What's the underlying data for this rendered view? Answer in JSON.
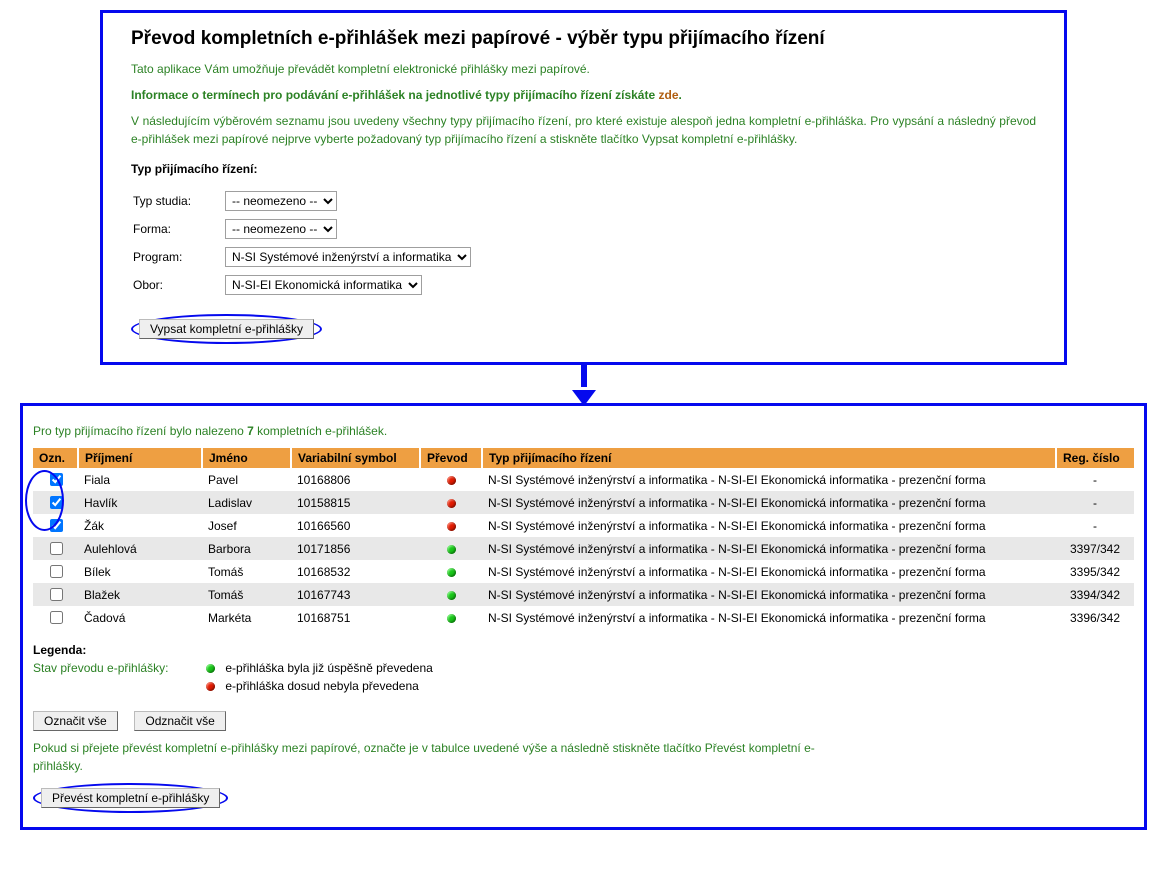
{
  "top": {
    "title": "Převod kompletních e-přihlášek mezi papírové - výběr typu přijímacího řízení",
    "intro": "Tato aplikace Vám umožňuje převádět kompletní elektronické přihlášky mezi papírové.",
    "info_prefix": "Informace o termínech pro podávání e-přihlášek na jednotlivé typy přijímacího řízení získáte ",
    "info_link": "zde",
    "info_suffix": ".",
    "desc": "V následujícím výběrovém seznamu jsou uvedeny všechny typy přijímacího řízení, pro které existuje alespoň jedna kompletní e-přihláška. Pro vypsání a následný převod e-přihlášek mezi papírové nejprve vyberte požadovaný typ přijímacího řízení a stiskněte tlačítko Vypsat kompletní e-přihlášky.",
    "sect_label": "Typ přijímacího řízení:",
    "form": {
      "typ_label": "Typ studia:",
      "typ_val": "-- neomezeno --",
      "forma_label": "Forma:",
      "forma_val": "-- neomezeno --",
      "program_label": "Program:",
      "program_val": "N-SI Systémové inženýrství a informatika",
      "obor_label": "Obor:",
      "obor_val": "N-SI-EI Ekonomická informatika"
    },
    "btn_list": "Vypsat kompletní e-přihlášky"
  },
  "bottom": {
    "found_pre": "Pro typ přijímacího řízení bylo nalezeno ",
    "found_n": "7",
    "found_post": " kompletních e-přihlášek.",
    "headers": {
      "ozn": "Ozn.",
      "prijmeni": "Příjmení",
      "jmeno": "Jméno",
      "vs": "Variabilní symbol",
      "prevod": "Převod",
      "typ": "Typ přijímacího řízení",
      "reg": "Reg. číslo"
    },
    "rows": [
      {
        "checked": true,
        "alt": false,
        "prijmeni": "Fiala",
        "jmeno": "Pavel",
        "vs": "10168806",
        "status": "red",
        "typ": "N-SI Systémové inženýrství a informatika - N-SI-EI Ekonomická informatika - prezenční forma",
        "reg": "-"
      },
      {
        "checked": true,
        "alt": true,
        "prijmeni": "Havlík",
        "jmeno": "Ladislav",
        "vs": "10158815",
        "status": "red",
        "typ": "N-SI Systémové inženýrství a informatika - N-SI-EI Ekonomická informatika - prezenční forma",
        "reg": "-"
      },
      {
        "checked": true,
        "alt": false,
        "prijmeni": "Žák",
        "jmeno": "Josef",
        "vs": "10166560",
        "status": "red",
        "typ": "N-SI Systémové inženýrství a informatika - N-SI-EI Ekonomická informatika - prezenční forma",
        "reg": "-"
      },
      {
        "checked": false,
        "alt": true,
        "prijmeni": "Aulehlová",
        "jmeno": "Barbora",
        "vs": "10171856",
        "status": "green",
        "typ": "N-SI Systémové inženýrství a informatika - N-SI-EI Ekonomická informatika - prezenční forma",
        "reg": "3397/342"
      },
      {
        "checked": false,
        "alt": false,
        "prijmeni": "Bílek",
        "jmeno": "Tomáš",
        "vs": "10168532",
        "status": "green",
        "typ": "N-SI Systémové inženýrství a informatika - N-SI-EI Ekonomická informatika - prezenční forma",
        "reg": "3395/342"
      },
      {
        "checked": false,
        "alt": true,
        "prijmeni": "Blažek",
        "jmeno": "Tomáš",
        "vs": "10167743",
        "status": "green",
        "typ": "N-SI Systémové inženýrství a informatika - N-SI-EI Ekonomická informatika - prezenční forma",
        "reg": "3394/342"
      },
      {
        "checked": false,
        "alt": false,
        "prijmeni": "Čadová",
        "jmeno": "Markéta",
        "vs": "10168751",
        "status": "green",
        "typ": "N-SI Systémové inženýrství a informatika - N-SI-EI Ekonomická informatika - prezenční forma",
        "reg": "3396/342"
      }
    ],
    "legend_label": "Legenda:",
    "legend_status_label": "Stav převodu e-přihlášky:",
    "legend_green": "e-přihláška byla již úspěšně převedena",
    "legend_red": "e-přihláška dosud nebyla převedena",
    "btn_select_all": "Označit vše",
    "btn_deselect_all": "Odznačit vše",
    "instr": "Pokud si přejete převést kompletní e-přihlášky mezi papírové, označte je v tabulce uvedené výše a následně stiskněte tlačítko Převést kompletní e-přihlášky.",
    "btn_convert": "Převést kompletní e-přihlášky"
  }
}
